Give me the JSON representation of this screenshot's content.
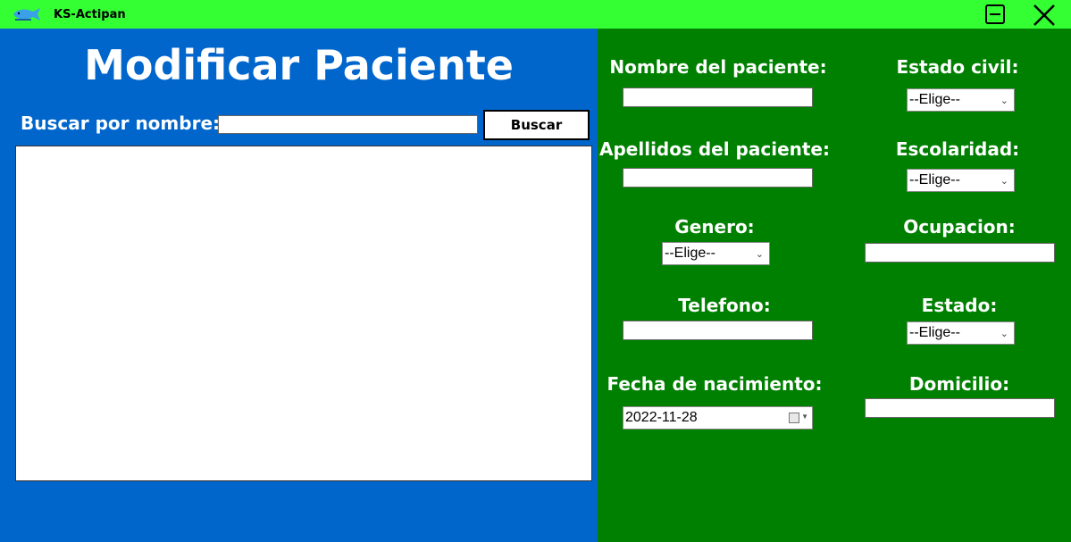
{
  "window": {
    "app_title": "KS-Actipan",
    "logo_icon": "fish-logo-icon",
    "minimize_icon": "minimize-icon",
    "close_icon": "close-icon",
    "titlebar_color": "#33ff33"
  },
  "left": {
    "page_title": "Modificar Paciente",
    "search_label": "Buscar por nombre:",
    "search_value": "",
    "search_button": "Buscar",
    "bg_color": "#0066cc"
  },
  "form": {
    "bg_color": "#008000",
    "nombre_label": "Nombre del paciente:",
    "nombre_value": "",
    "apellidos_label": "Apellidos del paciente:",
    "apellidos_value": "",
    "genero_label": "Genero:",
    "genero_value": "--Elige--",
    "telefono_label": "Telefono:",
    "telefono_value": "",
    "fecha_label": "Fecha de nacimiento:",
    "fecha_value": "2022-11-28",
    "estado_civil_label": "Estado civil:",
    "estado_civil_value": "--Elige--",
    "escolaridad_label": "Escolaridad:",
    "escolaridad_value": "--Elige--",
    "ocupacion_label": "Ocupacion:",
    "ocupacion_value": "",
    "estado_label": "Estado:",
    "estado_value": "--Elige--",
    "domicilio_label": "Domicilio:",
    "domicilio_value": ""
  }
}
